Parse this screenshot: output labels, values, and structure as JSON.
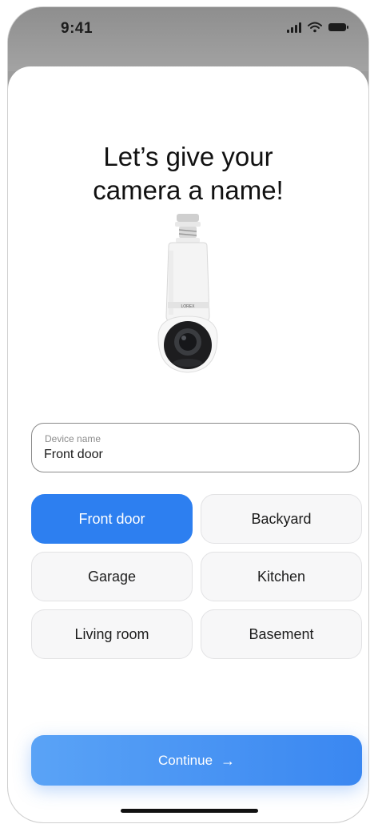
{
  "status_bar": {
    "time": "9:41",
    "icons": [
      "signal-icon",
      "wifi-icon",
      "battery-icon"
    ]
  },
  "title": {
    "line1": "Let’s give your",
    "line2": "camera a name!"
  },
  "camera": {
    "brand_text": "LOREX"
  },
  "device_name_field": {
    "label": "Device name",
    "value": "Front door"
  },
  "suggestions": [
    {
      "label": "Front door",
      "selected": true
    },
    {
      "label": "Backyard",
      "selected": false
    },
    {
      "label": "Garage",
      "selected": false
    },
    {
      "label": "Kitchen",
      "selected": false
    },
    {
      "label": "Living room",
      "selected": false
    },
    {
      "label": "Basement",
      "selected": false
    }
  ],
  "continue_button": {
    "label": "Continue",
    "icon": "arrow-right-icon",
    "arrow_glyph": "→"
  },
  "colors": {
    "accent": "#2d7ff0",
    "button_gradient_start": "#5aa3f6",
    "button_gradient_end": "#3a87f1"
  }
}
